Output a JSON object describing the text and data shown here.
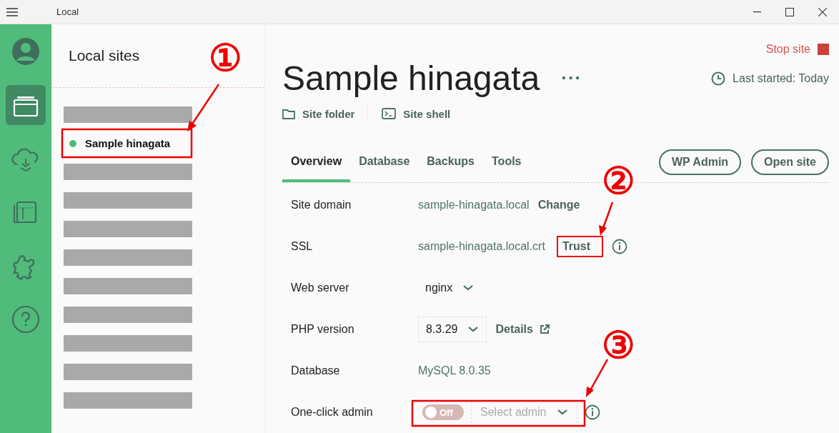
{
  "window": {
    "title": "Local"
  },
  "nav_items": [
    {
      "kind": "avatar",
      "selected": false
    },
    {
      "kind": "sites",
      "selected": true
    },
    {
      "kind": "cloud",
      "selected": false
    },
    {
      "kind": "blueprint",
      "selected": false
    },
    {
      "kind": "addons",
      "selected": false
    },
    {
      "kind": "help",
      "selected": false
    }
  ],
  "sites_panel": {
    "title": "Local sites",
    "sites": [
      {
        "kind": "redacted",
        "selected": false
      },
      {
        "kind": "site",
        "name": "Sample hinagata",
        "selected": true,
        "color": "#4fbb7a"
      },
      {
        "kind": "redacted",
        "selected": false
      },
      {
        "kind": "redacted",
        "selected": false
      },
      {
        "kind": "redacted",
        "selected": false
      },
      {
        "kind": "redacted",
        "selected": false
      },
      {
        "kind": "redacted",
        "selected": false
      },
      {
        "kind": "redacted",
        "selected": false
      },
      {
        "kind": "redacted",
        "selected": false
      },
      {
        "kind": "redacted",
        "selected": false
      },
      {
        "kind": "redacted",
        "selected": false
      }
    ]
  },
  "site": {
    "stop_label": "Stop site",
    "title": "Sample hinagata",
    "more": "···",
    "last_started": "Last started: Today",
    "links": [
      {
        "kind": "folder",
        "label": "Site folder"
      },
      {
        "kind": "terminal",
        "label": "Site shell"
      }
    ],
    "tabs": [
      {
        "label": "Overview",
        "selected": true
      },
      {
        "label": "Database",
        "selected": false
      },
      {
        "label": "Backups",
        "selected": false
      },
      {
        "label": "Tools",
        "selected": false
      }
    ],
    "buttons": [
      "WP Admin",
      "Open site"
    ],
    "rows": [
      {
        "kind": "link",
        "label": "Site domain",
        "value": "sample-hinagata.local",
        "action": "Change"
      },
      {
        "kind": "ssl",
        "label": "SSL",
        "value": "sample-hinagata.local.crt",
        "action": "Trust"
      },
      {
        "kind": "select",
        "label": "Web server",
        "value": "nginx"
      },
      {
        "kind": "select_link",
        "label": "PHP version",
        "value": "8.3.29",
        "action": "Details"
      },
      {
        "kind": "text",
        "label": "Database",
        "value": "MySQL 8.0.35"
      },
      {
        "kind": "admin",
        "label": "One-click admin",
        "toggle": {
          "on": false,
          "label": "Off"
        },
        "placeholder": "Select admin"
      }
    ]
  },
  "annotations": [
    {
      "label": "①"
    },
    {
      "label": "②"
    },
    {
      "label": "③"
    }
  ]
}
